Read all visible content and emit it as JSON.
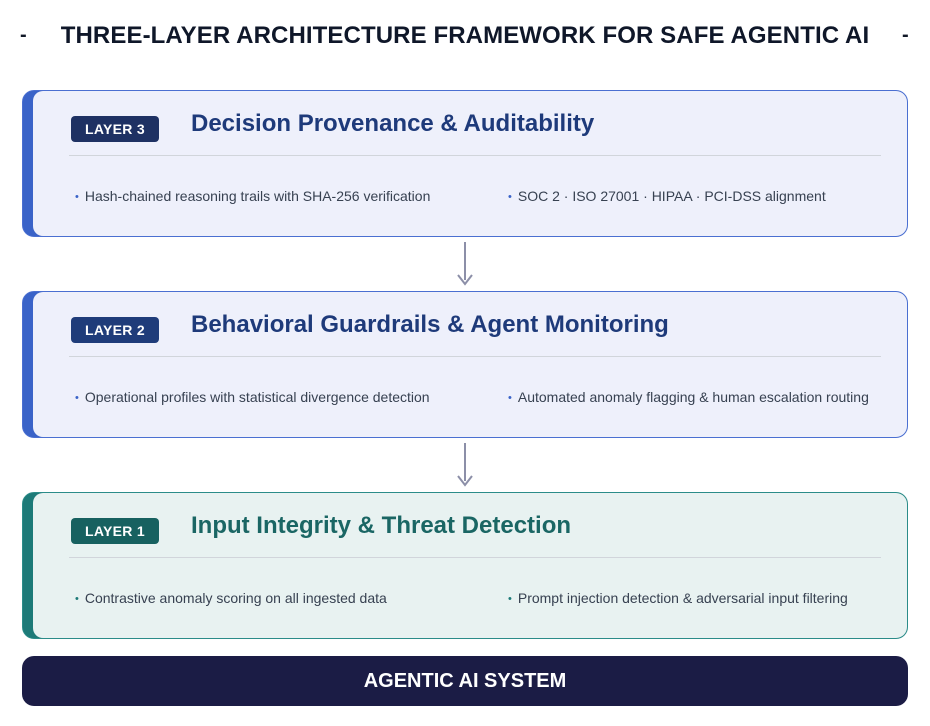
{
  "title": "THREE-LAYER ARCHITECTURE FRAMEWORK FOR SAFE AGENTIC AI",
  "title_dashes": [
    "-",
    "-"
  ],
  "layers": [
    {
      "badge": "LAYER 3",
      "title": "Decision Provenance & Auditability",
      "bullets": [
        "Hash-chained reasoning trails with SHA-256 verification",
        "SOC 2 · ISO 27001 · HIPAA · PCI-DSS alignment"
      ],
      "accent_color": "#3a63c8",
      "badge_color": "#1e3163",
      "title_color": "#1e3a7a",
      "bg_color": "#eef0fb",
      "border_color": "#4a6fd1"
    },
    {
      "badge": "LAYER 2",
      "title": "Behavioral Guardrails & Agent Monitoring",
      "bullets": [
        "Operational profiles with statistical divergence detection",
        "Automated anomaly flagging & human escalation routing"
      ],
      "accent_color": "#3a63c8",
      "badge_color": "#1f3c7a",
      "title_color": "#1e3a7a",
      "bg_color": "#eef0fb",
      "border_color": "#4a6fd1"
    },
    {
      "badge": "LAYER 1",
      "title": "Input Integrity & Threat Detection",
      "bullets": [
        "Contrastive anomaly scoring on all ingested data",
        "Prompt injection detection & adversarial input filtering"
      ],
      "accent_color": "#1d7a78",
      "badge_color": "#176160",
      "title_color": "#1a6664",
      "bg_color": "#e8f2f1",
      "border_color": "#2b8c89"
    }
  ],
  "system": {
    "label": "AGENTIC AI SYSTEM",
    "color": "#1b1c45"
  },
  "arrow_color": "#8c8fa8"
}
